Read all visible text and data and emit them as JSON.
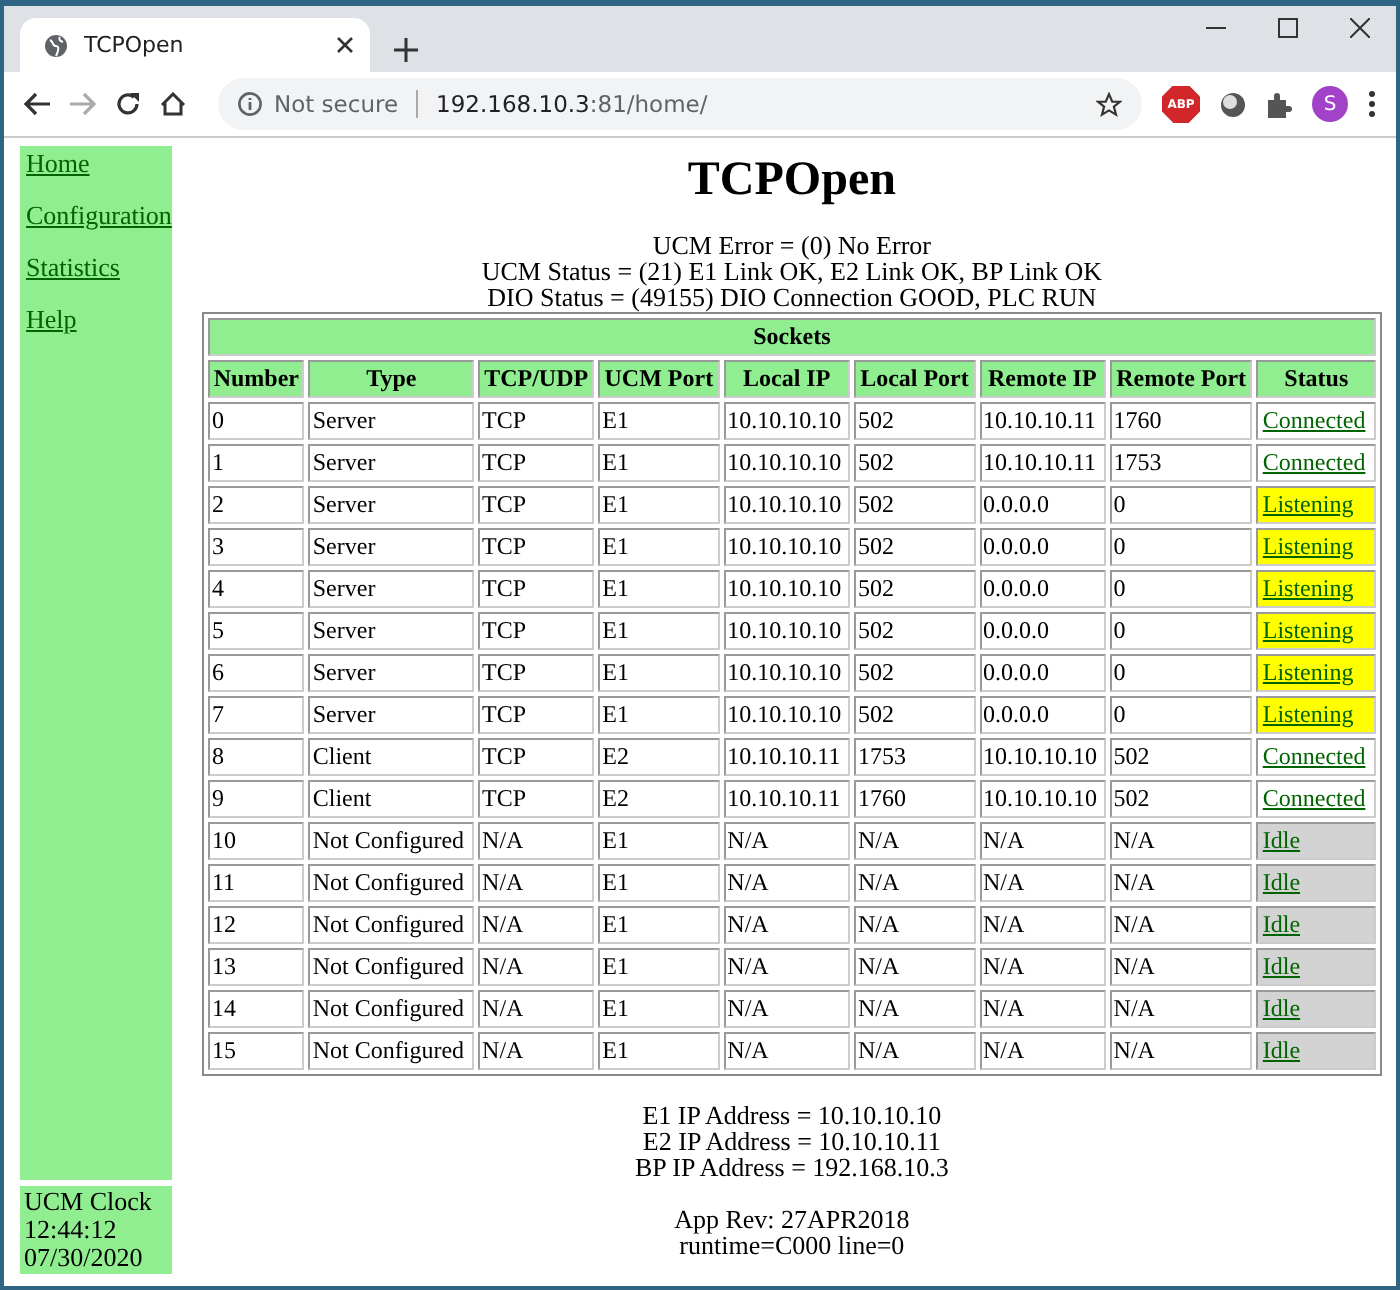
{
  "browser": {
    "tab_title": "TCPOpen",
    "address_prefix": "Not secure",
    "address_host": "192.168.10.3",
    "address_rest": ":81/home/",
    "profile_initial": "S",
    "extension_badge": "ABP"
  },
  "sidebar": {
    "links": [
      "Home",
      "Configuration",
      "Statistics",
      "Help"
    ],
    "clock": {
      "label": "UCM Clock",
      "time": "12:44:12",
      "date": "07/30/2020"
    }
  },
  "page": {
    "title": "TCPOpen",
    "status_lines": [
      "UCM Error = (0) No Error",
      "UCM Status = (21) E1 Link OK, E2 Link OK, BP Link OK",
      "DIO Status = (49155) DIO Connection GOOD, PLC RUN"
    ],
    "table": {
      "caption": "Sockets",
      "columns": [
        "Number",
        "Type",
        "TCP/UDP",
        "UCM Port",
        "Local IP",
        "Local Port",
        "Remote IP",
        "Remote Port",
        "Status"
      ],
      "rows": [
        {
          "cells": [
            "0",
            "Server",
            "TCP",
            "E1",
            "10.10.10.10",
            "502",
            "10.10.10.11",
            "1760"
          ],
          "status": "Connected",
          "kind": "connected"
        },
        {
          "cells": [
            "1",
            "Server",
            "TCP",
            "E1",
            "10.10.10.10",
            "502",
            "10.10.10.11",
            "1753"
          ],
          "status": "Connected",
          "kind": "connected"
        },
        {
          "cells": [
            "2",
            "Server",
            "TCP",
            "E1",
            "10.10.10.10",
            "502",
            "0.0.0.0",
            "0"
          ],
          "status": "Listening",
          "kind": "listening"
        },
        {
          "cells": [
            "3",
            "Server",
            "TCP",
            "E1",
            "10.10.10.10",
            "502",
            "0.0.0.0",
            "0"
          ],
          "status": "Listening",
          "kind": "listening"
        },
        {
          "cells": [
            "4",
            "Server",
            "TCP",
            "E1",
            "10.10.10.10",
            "502",
            "0.0.0.0",
            "0"
          ],
          "status": "Listening",
          "kind": "listening"
        },
        {
          "cells": [
            "5",
            "Server",
            "TCP",
            "E1",
            "10.10.10.10",
            "502",
            "0.0.0.0",
            "0"
          ],
          "status": "Listening",
          "kind": "listening"
        },
        {
          "cells": [
            "6",
            "Server",
            "TCP",
            "E1",
            "10.10.10.10",
            "502",
            "0.0.0.0",
            "0"
          ],
          "status": "Listening",
          "kind": "listening"
        },
        {
          "cells": [
            "7",
            "Server",
            "TCP",
            "E1",
            "10.10.10.10",
            "502",
            "0.0.0.0",
            "0"
          ],
          "status": "Listening",
          "kind": "listening"
        },
        {
          "cells": [
            "8",
            "Client",
            "TCP",
            "E2",
            "10.10.10.11",
            "1753",
            "10.10.10.10",
            "502"
          ],
          "status": "Connected",
          "kind": "connected"
        },
        {
          "cells": [
            "9",
            "Client",
            "TCP",
            "E2",
            "10.10.10.11",
            "1760",
            "10.10.10.10",
            "502"
          ],
          "status": "Connected",
          "kind": "connected"
        },
        {
          "cells": [
            "10",
            "Not Configured",
            "N/A",
            "E1",
            "N/A",
            "N/A",
            "N/A",
            "N/A"
          ],
          "status": "Idle",
          "kind": "idle"
        },
        {
          "cells": [
            "11",
            "Not Configured",
            "N/A",
            "E1",
            "N/A",
            "N/A",
            "N/A",
            "N/A"
          ],
          "status": "Idle",
          "kind": "idle"
        },
        {
          "cells": [
            "12",
            "Not Configured",
            "N/A",
            "E1",
            "N/A",
            "N/A",
            "N/A",
            "N/A"
          ],
          "status": "Idle",
          "kind": "idle"
        },
        {
          "cells": [
            "13",
            "Not Configured",
            "N/A",
            "E1",
            "N/A",
            "N/A",
            "N/A",
            "N/A"
          ],
          "status": "Idle",
          "kind": "idle"
        },
        {
          "cells": [
            "14",
            "Not Configured",
            "N/A",
            "E1",
            "N/A",
            "N/A",
            "N/A",
            "N/A"
          ],
          "status": "Idle",
          "kind": "idle"
        },
        {
          "cells": [
            "15",
            "Not Configured",
            "N/A",
            "E1",
            "N/A",
            "N/A",
            "N/A",
            "N/A"
          ],
          "status": "Idle",
          "kind": "idle"
        }
      ]
    },
    "address_lines": [
      "E1 IP Address = 10.10.10.10",
      "E2 IP Address = 10.10.10.11",
      "BP IP Address = 192.168.10.3"
    ],
    "footer_lines": [
      "App Rev: 27APR2018",
      "runtime=C000 line=0"
    ]
  }
}
